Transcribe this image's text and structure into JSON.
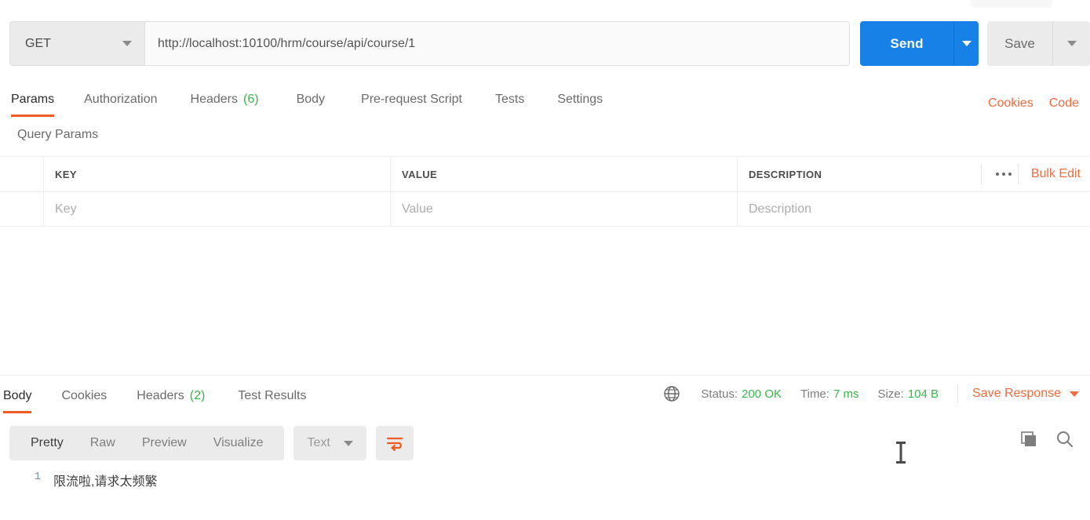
{
  "request": {
    "method": "GET",
    "url": "http://localhost:10100/hrm/course/api/course/1",
    "send_label": "Send",
    "save_label": "Save",
    "tabs": [
      {
        "label": "Params",
        "count": "",
        "active": true
      },
      {
        "label": "Authorization",
        "count": "",
        "active": false
      },
      {
        "label": "Headers",
        "count": "(6)",
        "active": false
      },
      {
        "label": "Body",
        "count": "",
        "active": false
      },
      {
        "label": "Pre-request Script",
        "count": "",
        "active": false
      },
      {
        "label": "Tests",
        "count": "",
        "active": false
      },
      {
        "label": "Settings",
        "count": "",
        "active": false
      }
    ],
    "links": [
      {
        "label": "Cookies"
      },
      {
        "label": "Code"
      }
    ]
  },
  "query_params": {
    "title": "Query Params",
    "columns": [
      "KEY",
      "VALUE",
      "DESCRIPTION"
    ],
    "placeholders": [
      "Key",
      "Value",
      "Description"
    ],
    "bulk_edit_label": "Bulk Edit",
    "more_icon": "ellipsis-icon"
  },
  "response": {
    "tabs": [
      {
        "label": "Body",
        "count": "",
        "active": true
      },
      {
        "label": "Cookies",
        "count": "",
        "active": false
      },
      {
        "label": "Headers",
        "count": "(2)",
        "active": false
      },
      {
        "label": "Test Results",
        "count": "",
        "active": false
      }
    ],
    "meta": {
      "status_label": "Status:",
      "status_value": "200 OK",
      "time_label": "Time:",
      "time_value": "7 ms",
      "size_label": "Size:",
      "size_value": "104 B",
      "globe_icon": "globe-icon"
    },
    "save_response_label": "Save Response",
    "view_modes": [
      {
        "label": "Pretty",
        "active": true
      },
      {
        "label": "Raw",
        "active": false
      },
      {
        "label": "Preview",
        "active": false
      },
      {
        "label": "Visualize",
        "active": false
      }
    ],
    "format": "Text",
    "wrap_icon": "wrap-lines-icon",
    "copy_icon": "copy-icon",
    "search_icon": "search-icon",
    "body_lines": [
      {
        "number": "1",
        "text": "限流啦,请求太频繁"
      }
    ]
  },
  "colors": {
    "accent_orange": "#ef5b25",
    "link_orange": "#ef6c3f",
    "send_blue": "#1781e8",
    "status_green": "#3bb54a"
  }
}
